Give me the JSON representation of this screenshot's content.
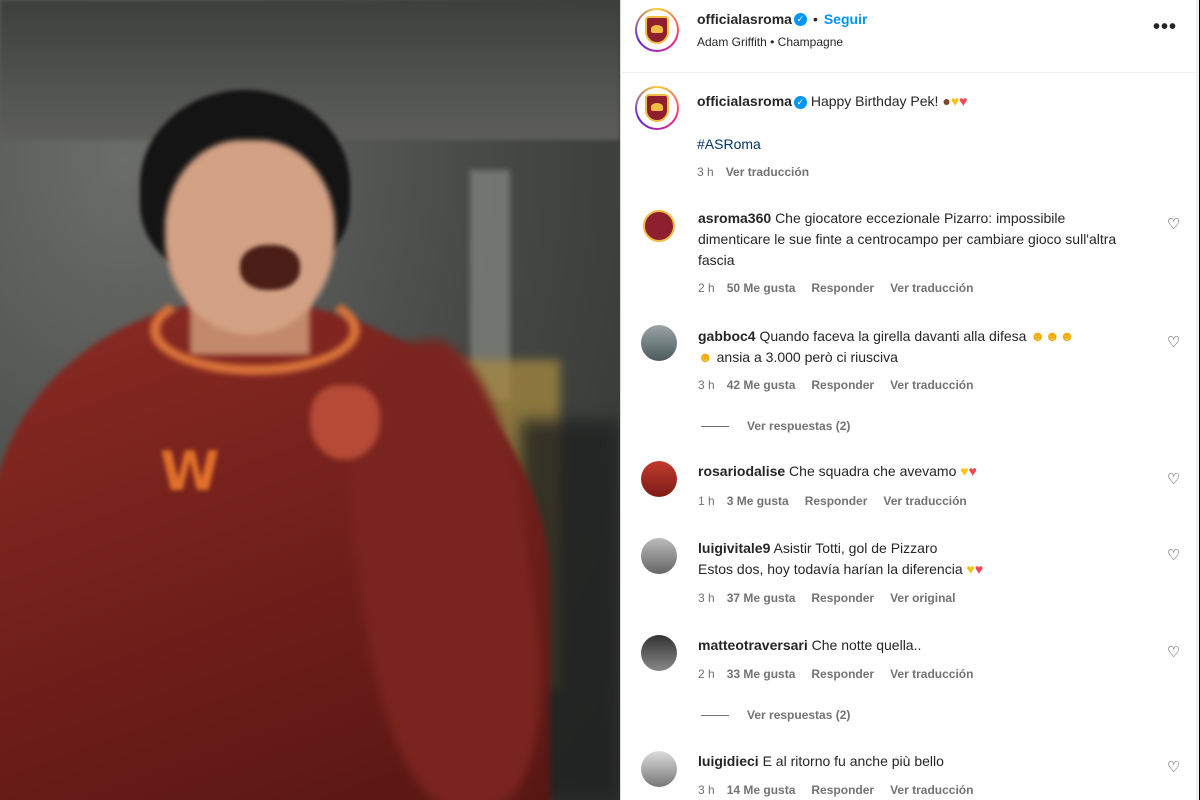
{
  "header": {
    "username": "officialasroma",
    "follow_label": "Seguir",
    "subtitle": "Adam Griffith • Champagne",
    "separator": "•"
  },
  "caption": {
    "username": "officialasroma",
    "text": "Happy Birthday Pek!",
    "hashtag": "#ASRoma",
    "time": "3 h",
    "translate": "Ver traducción"
  },
  "comments": [
    {
      "user": "asroma360",
      "text": "Che giocatore eccezionale Pizarro: impossibile dimenticare le sue finte a centrocampo per cambiare gioco sull'altra fascia",
      "time": "2 h",
      "likes": "50 Me gusta",
      "reply": "Responder",
      "translate": "Ver traducción"
    },
    {
      "user": "gabboc4",
      "text": "Quando faceva la girella davanti alla difesa",
      "text2": "ansia a 3.000 però ci riusciva",
      "time": "3 h",
      "likes": "42 Me gusta",
      "reply": "Responder",
      "translate": "Ver traducción",
      "replies": "Ver respuestas (2)"
    },
    {
      "user": "rosariodalise",
      "text": "Che squadra che avevamo",
      "time": "1 h",
      "likes": "3 Me gusta",
      "reply": "Responder",
      "translate": "Ver traducción"
    },
    {
      "user": "luigivitale9",
      "text": "Asistir Totti, gol de Pizzaro",
      "text2": "Estos dos, hoy todavía harían la diferencia",
      "time": "3 h",
      "likes": "37 Me gusta",
      "reply": "Responder",
      "translate": "Ver original"
    },
    {
      "user": "matteotraversari",
      "text": "Che notte quella..",
      "time": "2 h",
      "likes": "33 Me gusta",
      "reply": "Responder",
      "translate": "Ver traducción",
      "replies": "Ver respuestas (2)"
    },
    {
      "user": "luigidieci",
      "text": "E al ritorno fu anche più bello",
      "time": "3 h",
      "likes": "14 Me gusta",
      "reply": "Responder",
      "translate": "Ver traducción"
    }
  ],
  "media": {
    "sponsor": "W"
  },
  "colors": {
    "link": "#0095f6",
    "muted": "#737373",
    "text": "#262626",
    "roma": "#8e1f2f",
    "gold": "#f0bc42"
  }
}
